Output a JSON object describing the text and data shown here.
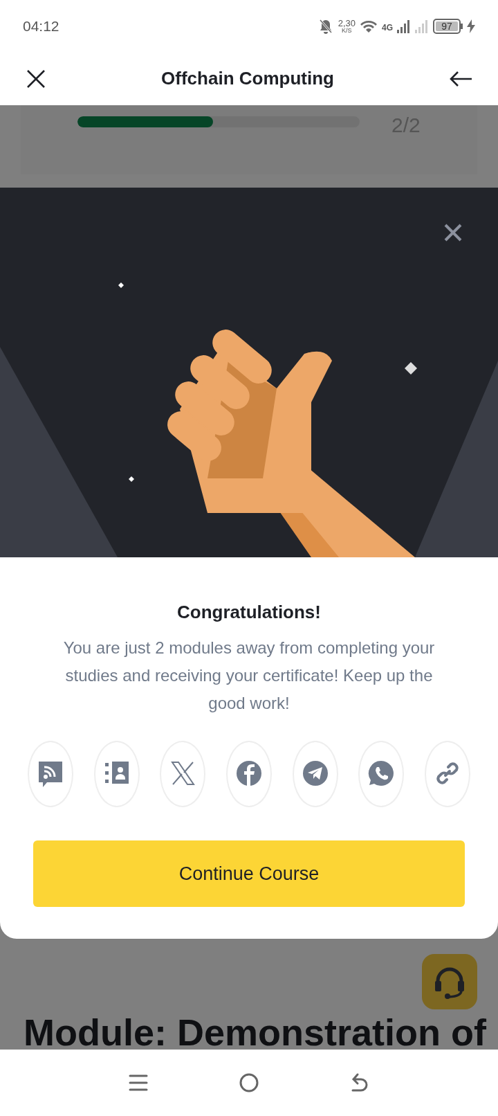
{
  "status_bar": {
    "time": "04:12",
    "net_speed": "2,30",
    "net_unit": "K/S",
    "network": "4G",
    "battery": "97"
  },
  "header": {
    "title": "Offchain Computing"
  },
  "progress": {
    "level": 0.48,
    "count": "2/2"
  },
  "modal": {
    "title": "Congratulations!",
    "message": "You are just 2 modules away from completing your studies and receiving your certificate! Keep up the good work!",
    "button": "Continue Course"
  },
  "module_heading": "Module: Demonstration of"
}
